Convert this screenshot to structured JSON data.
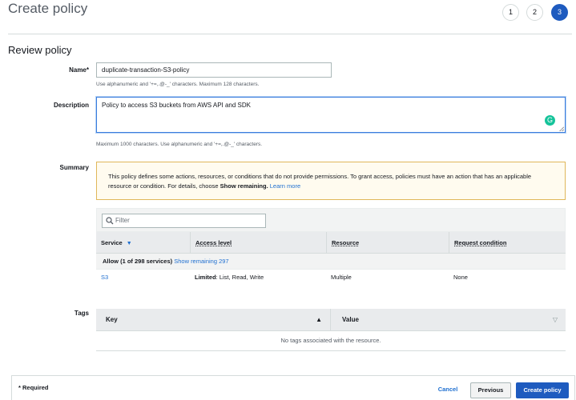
{
  "page": {
    "title": "Create policy"
  },
  "steps": [
    "1",
    "2",
    "3"
  ],
  "section": {
    "title": "Review policy"
  },
  "form": {
    "name_label": "Name*",
    "name_value": "duplicate-transaction-S3-policy",
    "name_help": "Use alphanumeric and '+=,.@-_' characters. Maximum 128 characters.",
    "description_label": "Description",
    "description_value": "Policy to access S3 buckets from AWS API and SDK",
    "description_help": "Maximum 1000 characters. Use alphanumeric and '+=,.@-_' characters."
  },
  "summary": {
    "label": "Summary",
    "warning_text": "This policy defines some actions, resources, or conditions that do not provide permissions. To grant access, policies must have an action that has an applicable resource or condition. For details, choose ",
    "warning_bold": "Show remaining.",
    "warning_link": "Learn more",
    "filter_placeholder": "Filter",
    "columns": [
      "Service",
      "Access level",
      "Resource",
      "Request condition"
    ],
    "group_label": "Allow (1 of 298 services)",
    "group_link": "Show remaining 297",
    "rows": [
      {
        "service": "S3",
        "access_bold": "Limited",
        "access_rest": ": List, Read, Write",
        "resource": "Multiple",
        "condition": "None"
      }
    ]
  },
  "tags": {
    "label": "Tags",
    "columns": [
      "Key",
      "Value"
    ],
    "empty_text": "No tags associated with the resource."
  },
  "footer": {
    "required_note": "* Required",
    "cancel": "Cancel",
    "previous": "Previous",
    "create": "Create policy"
  },
  "colors": {
    "primary": "#1e5bbf",
    "link": "#1f6fd0",
    "warning_border": "#e0b75a",
    "warning_bg": "#fffbef"
  },
  "icons": [
    "search-icon",
    "sort-down-icon",
    "sort-up-icon",
    "grammarly-icon"
  ]
}
